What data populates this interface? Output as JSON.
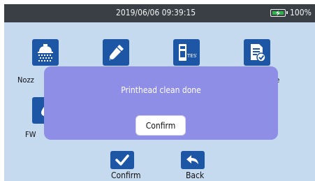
{
  "status_bar": {
    "datetime": "2019/06/06 09:39:15",
    "battery_percent": "100%",
    "battery_level": 1.0,
    "battery_color": "#2fb34a"
  },
  "menu": {
    "items": [
      {
        "label": "Nozz",
        "icon": "shower-nozzle-icon"
      },
      {
        "label": "",
        "icon": "ink-dropper-icon"
      },
      {
        "label": "",
        "icon": "test-print-icon"
      },
      {
        "label": "ge",
        "icon": "document-check-icon"
      },
      {
        "label": "FW",
        "icon": "firmware-icon"
      }
    ]
  },
  "dialog": {
    "message": "Printhead clean done",
    "confirm_label": "Confirm",
    "background_color": "#8f8ee7"
  },
  "footer": {
    "confirm_label": "Confirm",
    "back_label": "Back"
  },
  "colors": {
    "accent": "#1e56a6",
    "screen_background": "#c5d9ef",
    "status_bar": "#3a3f45"
  }
}
